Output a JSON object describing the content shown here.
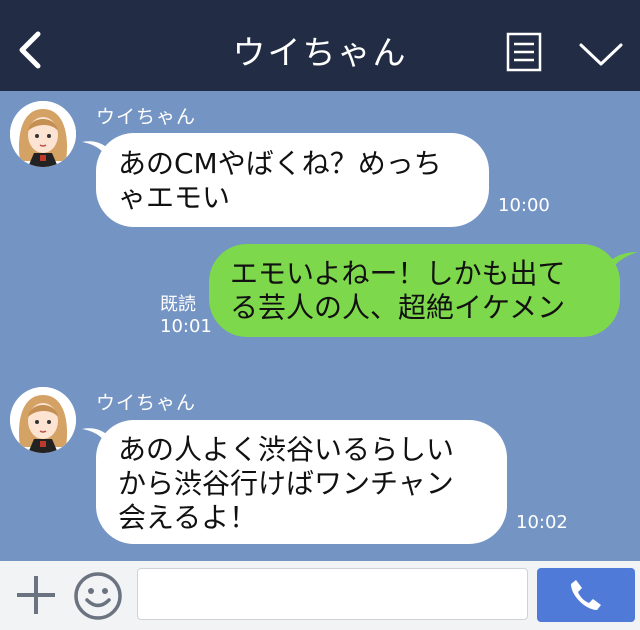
{
  "header": {
    "title": "ウイちゃん",
    "back_icon": "chevron-left-icon",
    "menu_icon": "note-menu-icon",
    "collapse_icon": "chevron-down-icon",
    "background": "#222d45"
  },
  "messages": [
    {
      "side": "left",
      "sender": "ウイちゃん",
      "lines": [
        "あのCMやばくね？めっち",
        "ゃエモい"
      ],
      "time": "10:00"
    },
    {
      "side": "right",
      "read": "既読",
      "time": "10:01",
      "lines": [
        "エモいよねー！しかも出て",
        "る芸人の人、超絶イケメン"
      ]
    },
    {
      "side": "left",
      "sender": "ウイちゃん",
      "lines": [
        "あの人よく渋谷いるらしい",
        "から渋谷行けばワンチャン",
        "会えるよ！"
      ],
      "time": "10:02"
    }
  ],
  "composer": {
    "plus_icon": "plus-icon",
    "emoji_icon": "smile-icon",
    "input_value": "",
    "send_icon": "phone-icon",
    "send_color": "#4f7ad8"
  },
  "colors": {
    "chat_background": "#7494c4",
    "incoming_bubble": "#ffffff",
    "outgoing_bubble": "#7ed84b"
  }
}
